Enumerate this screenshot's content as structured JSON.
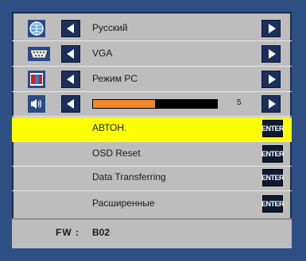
{
  "menu": {
    "language": {
      "label": "Русский",
      "icon": "globe-icon"
    },
    "input": {
      "label": "VGA",
      "icon": "vga-connector-icon"
    },
    "mode": {
      "label": "Режим PC",
      "icon": "display-mode-icon"
    },
    "volume": {
      "value": "5",
      "level": 0.5,
      "icon": "speaker-icon"
    },
    "actions": [
      {
        "label": "АВТОН.",
        "button": "ENTER",
        "selected": true
      },
      {
        "label": "OSD Reset",
        "button": "ENTER",
        "selected": false
      },
      {
        "label": "Data Transferring",
        "button": "ENTER",
        "selected": false
      },
      {
        "label": "Расширенные",
        "button": "ENTER",
        "selected": false
      }
    ]
  },
  "footer": {
    "fw_label": "FW :",
    "fw_value": "B02"
  },
  "colors": {
    "background": "#2d4f84",
    "panel": "#bdbdbd",
    "selected": "#ffff00",
    "slider_fill": "#f0872a"
  }
}
